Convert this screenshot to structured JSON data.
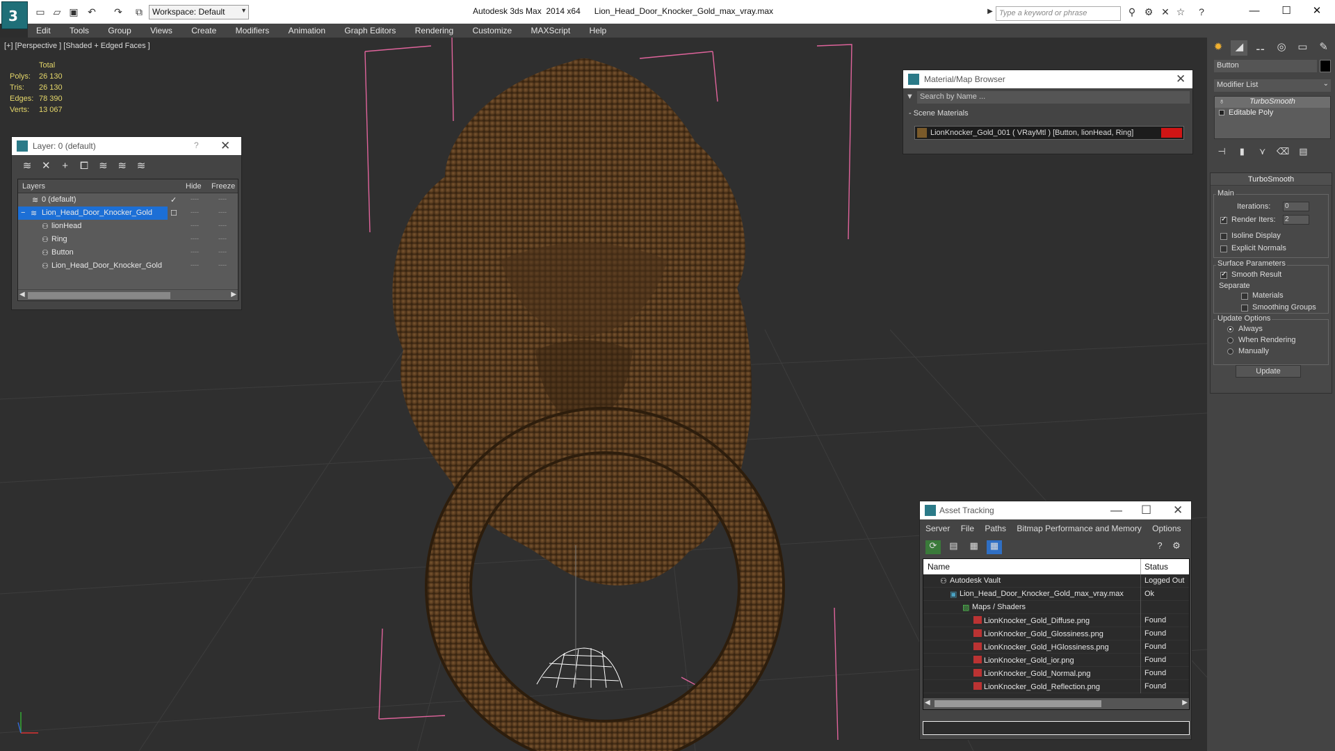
{
  "app": {
    "title": "Autodesk 3ds Max  2014 x64      Lion_Head_Door_Knocker_Gold_max_vray.max",
    "workspace": "Workspace: Default",
    "search_placeholder": "Type a keyword or phrase"
  },
  "menu": [
    "Edit",
    "Tools",
    "Group",
    "Views",
    "Create",
    "Modifiers",
    "Animation",
    "Graph Editors",
    "Rendering",
    "Customize",
    "MAXScript",
    "Help"
  ],
  "viewport": {
    "label": "[+] [Perspective ] [Shaded + Edged Faces ]",
    "stats_header": "Total",
    "stats": [
      {
        "label": "Polys:",
        "value": "26 130"
      },
      {
        "label": "Tris:",
        "value": "26 130"
      },
      {
        "label": "Edges:",
        "value": "78 390"
      },
      {
        "label": "Verts:",
        "value": "13 067"
      }
    ]
  },
  "layer_panel": {
    "title": "Layer: 0 (default)",
    "help": "?",
    "col_layers": "Layers",
    "col_hide": "Hide",
    "col_freeze": "Freeze",
    "rows": [
      {
        "name": "0 (default)"
      },
      {
        "name": "Lion_Head_Door_Knocker_Gold"
      },
      {
        "name": "lionHead"
      },
      {
        "name": "Ring"
      },
      {
        "name": "Button"
      },
      {
        "name": "Lion_Head_Door_Knocker_Gold"
      }
    ]
  },
  "material_browser": {
    "title": "Material/Map Browser",
    "search_placeholder": "Search by Name ...",
    "section": "- Scene Materials",
    "material": "LionKnocker_Gold_001  ( VRayMtl ) [Button, lionHead, Ring]",
    "swatch_color": "#d01515"
  },
  "asset_tracking": {
    "title": "Asset Tracking",
    "menu": [
      "Server",
      "File",
      "Paths",
      "Bitmap Performance and Memory",
      "Options"
    ],
    "col_name": "Name",
    "col_status": "Status",
    "rows": [
      {
        "name": "Autodesk Vault",
        "status": "Logged Out"
      },
      {
        "name": "Lion_Head_Door_Knocker_Gold_max_vray.max",
        "status": "Ok"
      },
      {
        "name": "Maps / Shaders",
        "status": ""
      },
      {
        "name": "LionKnocker_Gold_Diffuse.png",
        "status": "Found"
      },
      {
        "name": "LionKnocker_Gold_Glossiness.png",
        "status": "Found"
      },
      {
        "name": "LionKnocker_Gold_HGlossiness.png",
        "status": "Found"
      },
      {
        "name": "LionKnocker_Gold_ior.png",
        "status": "Found"
      },
      {
        "name": "LionKnocker_Gold_Normal.png",
        "status": "Found"
      },
      {
        "name": "LionKnocker_Gold_Reflection.png",
        "status": "Found"
      }
    ]
  },
  "command_panel": {
    "object_name": "Button",
    "modifier_list": "Modifier List",
    "stack": [
      "TurboSmooth",
      "Editable Poly"
    ],
    "turbosmooth": {
      "title": "TurboSmooth",
      "main": "Main",
      "iterations_label": "Iterations:",
      "iterations": "0",
      "render_iters_label": "Render Iters:",
      "render_iters": "2",
      "isoline": "Isoline Display",
      "explicit_normals": "Explicit Normals",
      "surface_params": "Surface Parameters",
      "smooth_result": "Smooth Result",
      "separate": "Separate",
      "materials": "Materials",
      "smoothing_groups": "Smoothing Groups",
      "update_options": "Update Options",
      "always": "Always",
      "when_rendering": "When Rendering",
      "manually": "Manually",
      "update": "Update"
    }
  }
}
